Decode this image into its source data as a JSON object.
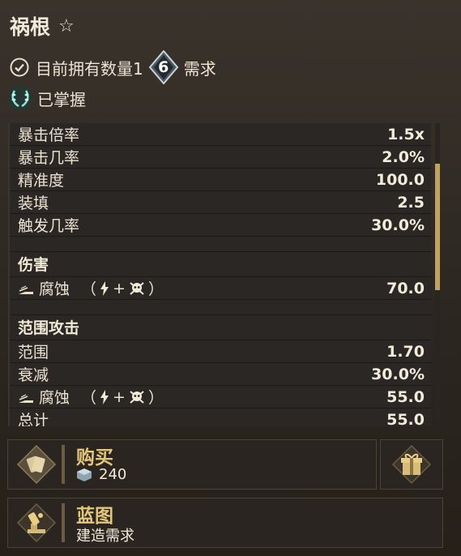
{
  "item": {
    "title": "祸根"
  },
  "status": {
    "owned_text": "目前拥有数量1",
    "required_count": "6",
    "required_label": "需求",
    "mastered_text": "已掌握"
  },
  "stats": {
    "basic": [
      {
        "label": "暴击倍率",
        "value": "1.5x"
      },
      {
        "label": "暴击几率",
        "value": "2.0%"
      },
      {
        "label": "精准度",
        "value": "100.0"
      },
      {
        "label": "装填",
        "value": "2.5"
      },
      {
        "label": "触发几率",
        "value": "30.0%"
      }
    ],
    "damage": {
      "header": "伤害",
      "corrosion_label": "腐蚀",
      "open_paren": "（",
      "plus": "+",
      "close_paren": "）",
      "corrosion_value": "70.0"
    },
    "aoe": {
      "header": "范围攻击",
      "range_label": "范围",
      "range_value": "1.70",
      "falloff_label": "衰减",
      "falloff_value": "30.0%",
      "corrosion_label": "腐蚀",
      "open_paren": "（",
      "plus": "+",
      "close_paren": "）",
      "corrosion_value": "55.0",
      "total_label": "总计",
      "total_value": "55.0"
    }
  },
  "buy": {
    "title": "购买",
    "price": "240"
  },
  "blueprint": {
    "title": "蓝图",
    "subtitle": "建造需求"
  },
  "colors": {
    "accent_gold": "#e2c77a",
    "scroll_thumb": "#bfa35f",
    "mastered_teal": "#4fc9b8"
  },
  "icons": [
    "star-icon",
    "checkmark-circle-icon",
    "diamond-count-icon",
    "laurel-icon",
    "damage-type-icon",
    "lightning-icon",
    "skull-icon",
    "credits-icon",
    "tags-icon",
    "gift-icon",
    "blueprint-machine-icon"
  ]
}
